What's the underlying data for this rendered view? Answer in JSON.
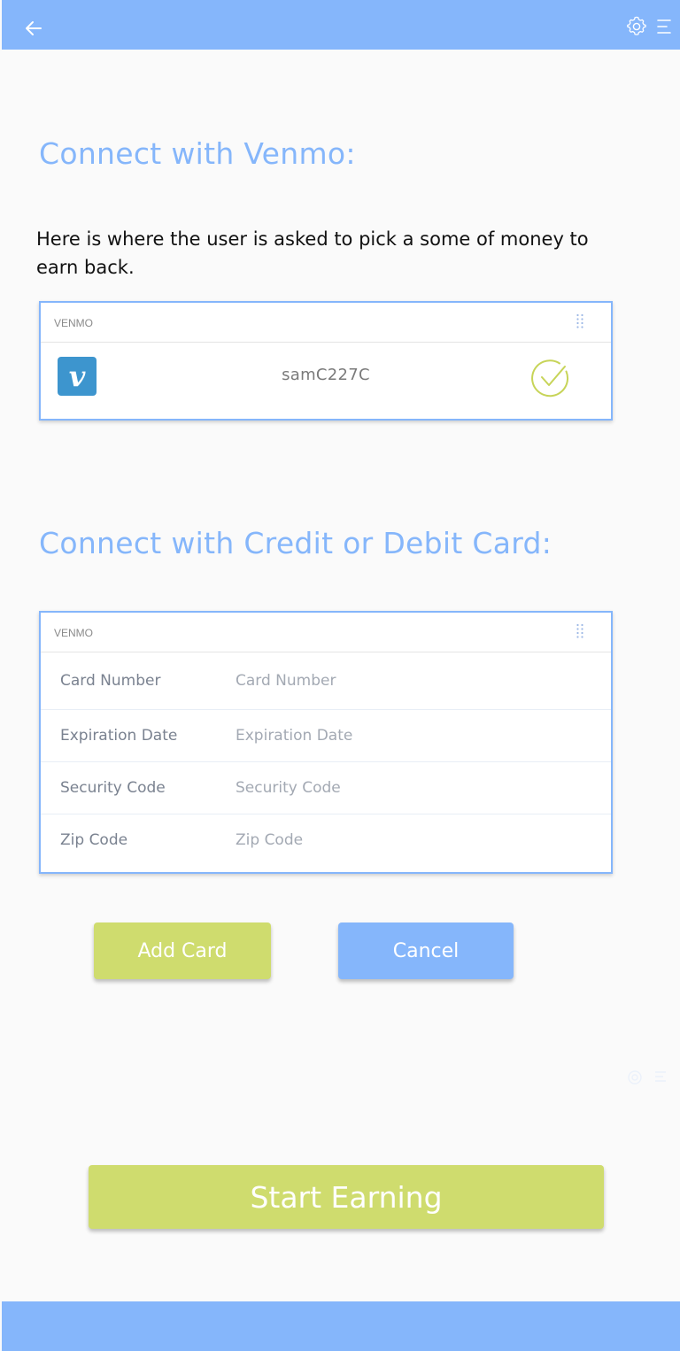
{
  "header": {
    "back_icon": "arrow-left-icon",
    "settings_icon": "gear-icon",
    "menu_icon": "menu-icon"
  },
  "venmo_section": {
    "title": "Connect with Venmo:",
    "description": "Here is where the user is asked to pick a some of money to earn back.",
    "panel": {
      "label": "VENMO",
      "logo_letter": "v",
      "username": "samC227C",
      "status_icon": "checkmark-circle-icon"
    }
  },
  "card_section": {
    "title": "Connect with Credit or Debit Card:",
    "panel": {
      "label": "VENMO",
      "fields": [
        {
          "label": "Card Number",
          "placeholder": "Card Number",
          "value": ""
        },
        {
          "label": "Expiration Date",
          "placeholder": "Expiration Date",
          "value": ""
        },
        {
          "label": "Security Code",
          "placeholder": "Security Code",
          "value": ""
        },
        {
          "label": "Zip Code",
          "placeholder": "Zip Code",
          "value": ""
        }
      ]
    }
  },
  "actions": {
    "add_card_label": "Add Card",
    "cancel_label": "Cancel",
    "start_label": "Start Earning"
  },
  "colors": {
    "primary_blue": "#85b6fb",
    "accent_green": "#cfdc6e",
    "venmo_blue": "#3d95ce",
    "background": "#fafafa"
  }
}
